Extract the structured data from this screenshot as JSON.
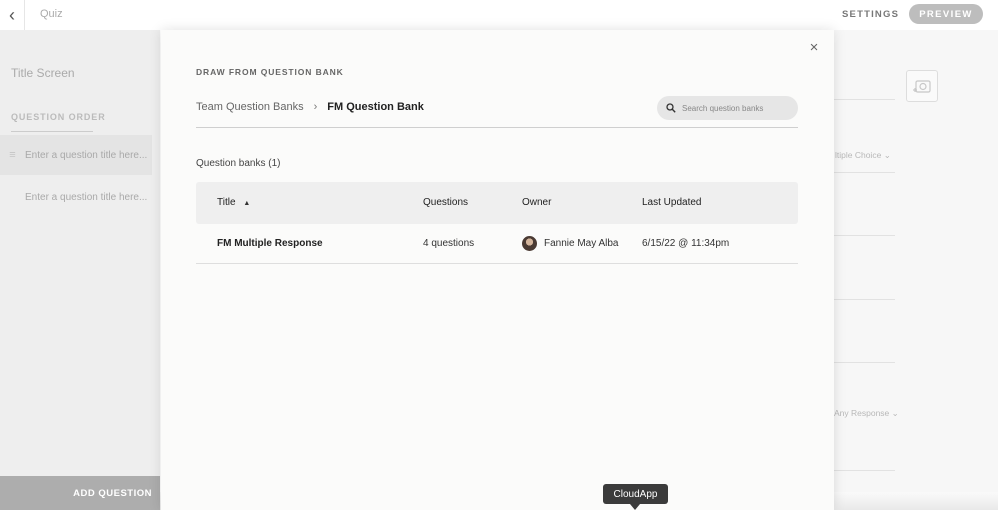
{
  "app": {
    "title": "Quiz",
    "settings_label": "SETTINGS",
    "preview_label": "PREVIEW"
  },
  "left_panel": {
    "title_screen": "Title Screen",
    "question_order_label": "QUESTION ORDER",
    "questions": [
      {
        "placeholder": "Enter a question title here..."
      },
      {
        "placeholder": "Enter a question title here..."
      }
    ],
    "add_question_label": "ADD QUESTION"
  },
  "right_panel": {
    "dropdown_1": "ltiple Choice",
    "dropdown_2": "Any Response"
  },
  "modal": {
    "heading": "DRAW FROM QUESTION BANK",
    "breadcrumb": {
      "parent": "Team Question Banks",
      "separator": "›",
      "current": "FM Question Bank"
    },
    "search": {
      "placeholder": "Search question banks",
      "value": ""
    },
    "banks_count": "Question banks (1)",
    "table": {
      "headers": {
        "title": "Title",
        "title_sort_indicator": "▲",
        "questions": "Questions",
        "owner": "Owner",
        "last_updated": "Last Updated"
      },
      "rows": [
        {
          "title": "FM Multiple Response",
          "questions": "4 questions",
          "owner": "Fannie May Alba",
          "last_updated": "6/15/22 @ 11:34pm"
        }
      ]
    }
  },
  "tooltip": {
    "label": "CloudApp"
  },
  "icons": {
    "back": "chevron-left-icon",
    "close": "close-icon",
    "search": "search-icon",
    "sort": "sort-ascending-icon",
    "camera": "add-image-icon",
    "dropdown": "chevron-down-icon"
  }
}
